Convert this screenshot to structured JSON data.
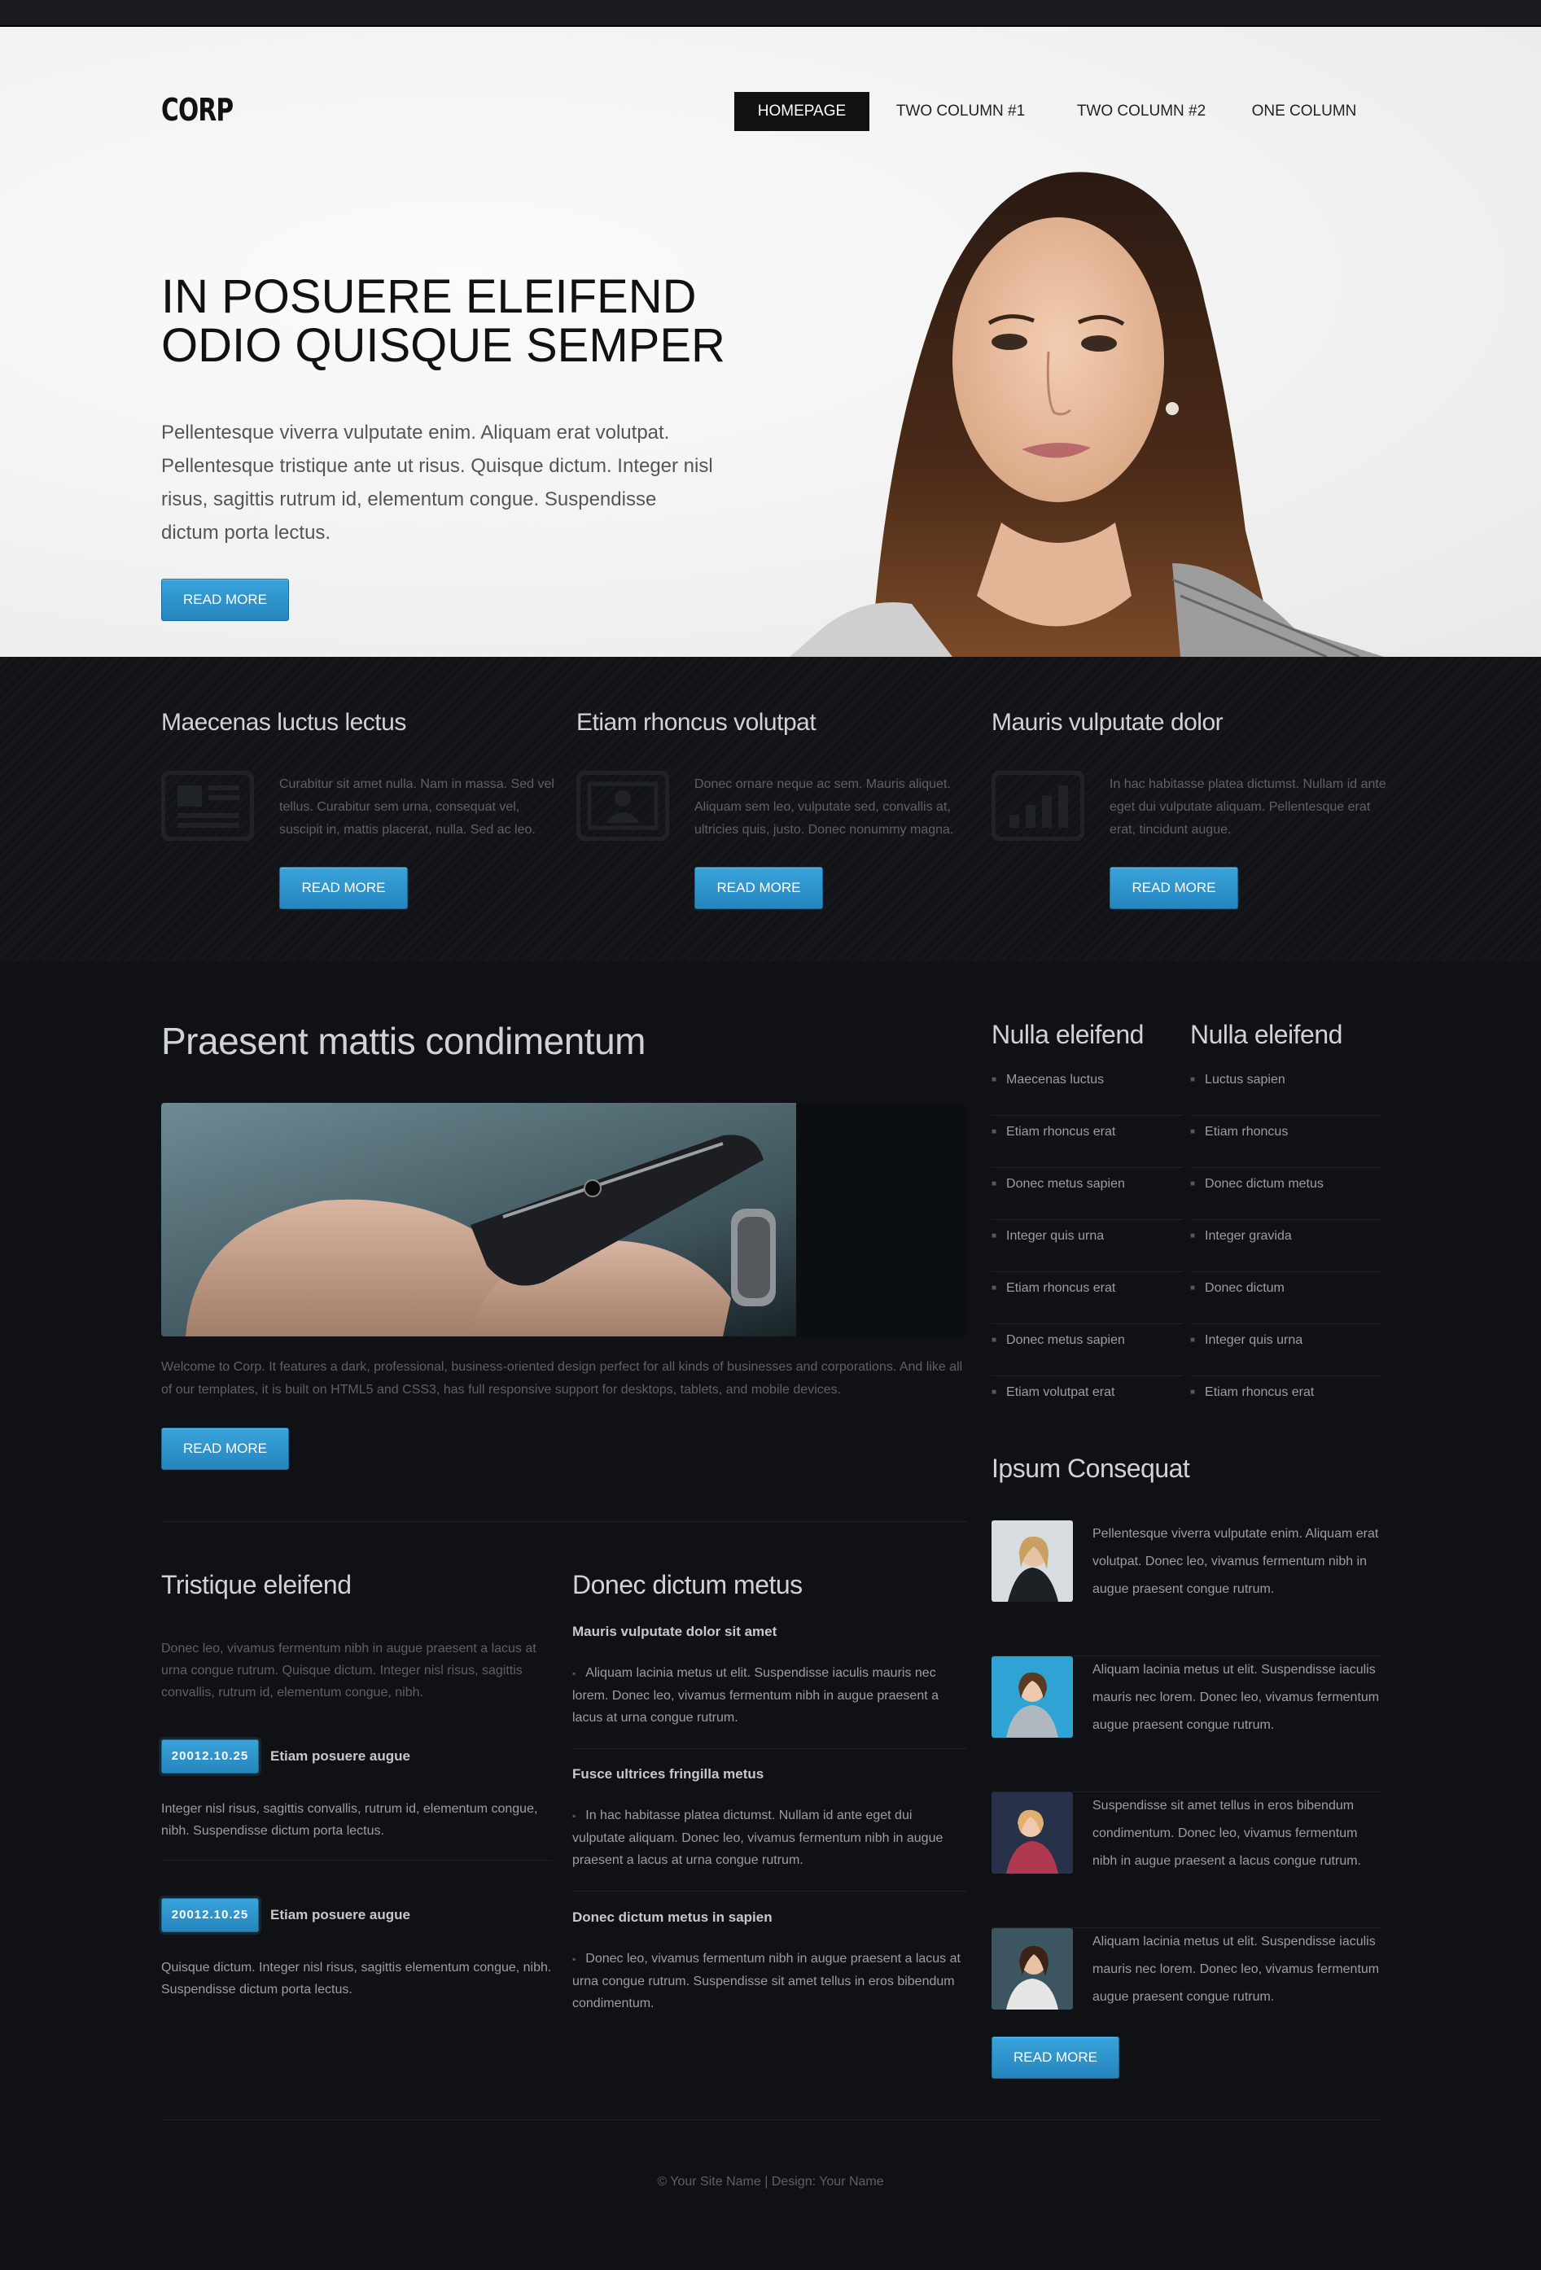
{
  "header": {
    "logo": "CORP",
    "nav": [
      "HOMEPAGE",
      "TWO COLUMN #1",
      "TWO COLUMN #2",
      "ONE COLUMN"
    ]
  },
  "hero": {
    "title": "IN POSUERE ELEIFEND ODIO QUISQUE SEMPER",
    "text": "Pellentesque viverra vulputate enim. Aliquam erat volutpat. Pellentesque tristique ante ut risus. Quisque dictum. Integer nisl risus, sagittis rutrum id, elementum congue. Suspendisse dictum porta lectus.",
    "button": "READ MORE"
  },
  "features": [
    {
      "title": "Maecenas luctus lectus",
      "icon": "newspaper-icon",
      "text": "Curabitur sit amet nulla. Nam in massa. Sed vel tellus. Curabitur sem urna, consequat vel, suscipit in, mattis placerat, nulla. Sed ac leo.",
      "button": "READ MORE"
    },
    {
      "title": "Etiam rhoncus volutpat",
      "icon": "id-card-icon",
      "text": "Donec ornare neque ac sem. Mauris aliquet. Aliquam sem leo, vulputate sed, convallis at, ultricies quis, justo. Donec nonummy magna.",
      "button": "READ MORE"
    },
    {
      "title": "Mauris vulputate dolor",
      "icon": "bar-chart-icon",
      "text": "In hac habitasse platea dictumst. Nullam id ante eget dui vulputate aliquam. Pellentesque erat erat, tincidunt augue.",
      "button": "READ MORE"
    }
  ],
  "main": {
    "title": "Praesent mattis condimentum",
    "intro": "Welcome to Corp. It features a dark, professional, business-oriented design perfect for all kinds of businesses and corporations. And like all of our templates, it is built on HTML5 and CSS3, has full responsive support for desktops, tablets, and mobile devices.",
    "button": "READ MORE"
  },
  "tristique": {
    "title": "Tristique eleifend",
    "text": "Donec leo, vivamus fermentum nibh in augue praesent a lacus at urna congue rutrum. Quisque dictum. Integer nisl risus, sagittis convallis, rutrum id, elementum congue, nibh.",
    "posts": [
      {
        "date": "20012.10.25",
        "title": "Etiam posuere augue",
        "text": "Integer nisl risus, sagittis convallis, rutrum id, elementum congue, nibh. Suspendisse dictum porta lectus."
      },
      {
        "date": "20012.10.25",
        "title": "Etiam posuere augue",
        "text": "Quisque dictum. Integer nisl risus, sagittis elementum congue, nibh. Suspendisse dictum porta lectus."
      }
    ]
  },
  "donec": {
    "title": "Donec dictum metus",
    "items": [
      {
        "title": "Mauris vulputate dolor sit amet",
        "text": "Aliquam lacinia metus ut elit. Suspendisse iaculis mauris nec lorem. Donec leo, vivamus fermentum nibh in augue praesent a lacus at urna congue rutrum."
      },
      {
        "title": "Fusce ultrices fringilla metus",
        "text": "In hac habitasse platea dictumst. Nullam id ante eget dui vulputate aliquam. Donec leo, vivamus fermentum nibh in augue praesent a lacus at urna congue rutrum."
      },
      {
        "title": "Donec dictum metus in sapien",
        "text": "Donec leo, vivamus fermentum nibh in augue praesent a lacus at urna congue rutrum. Suspendisse sit amet tellus in eros bibendum condimentum."
      }
    ]
  },
  "sidebar": {
    "col1": {
      "title": "Nulla eleifend",
      "items": [
        "Maecenas luctus",
        "Etiam rhoncus erat",
        "Donec metus sapien",
        "Integer quis urna",
        "Etiam rhoncus erat",
        "Donec metus sapien",
        "Etiam volutpat erat"
      ]
    },
    "col2": {
      "title": "Nulla eleifend",
      "items": [
        "Luctus sapien",
        "Etiam rhoncus",
        "Donec dictum metus",
        "Integer gravida",
        "Donec dictum",
        "Integer quis urna",
        "Etiam rhoncus erat"
      ]
    },
    "ipsum": {
      "title": "Ipsum Consequat",
      "items": [
        "Pellentesque viverra vulputate enim. Aliquam erat volutpat. Donec leo, vivamus fermentum nibh in augue praesent congue rutrum.",
        "Aliquam lacinia metus ut elit. Suspendisse iaculis mauris nec lorem. Donec leo, vivamus fermentum augue praesent congue rutrum.",
        "Suspendisse sit amet tellus in eros bibendum condimentum. Donec leo, vivamus fermentum nibh in augue praesent a lacus congue rutrum.",
        "Aliquam lacinia metus ut elit. Suspendisse iaculis mauris nec lorem. Donec leo, vivamus fermentum augue praesent congue rutrum."
      ],
      "button": "READ MORE"
    }
  },
  "footer": "© Your Site Name | Design: Your Name",
  "colors": {
    "accent": "#2a8ac5",
    "background": "#0f1114",
    "hero_bg": "#f1f1f1"
  }
}
